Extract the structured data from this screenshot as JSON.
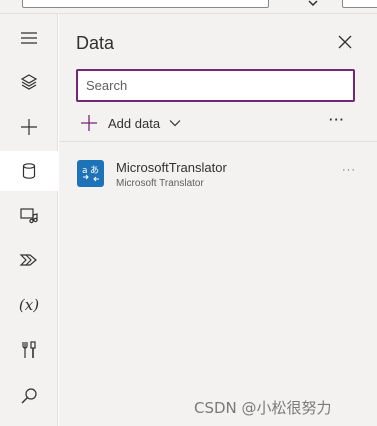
{
  "panel": {
    "title": "Data",
    "search_placeholder": "Search",
    "add_data_label": "Add data",
    "more_label": "···"
  },
  "rail": {
    "items": [
      {
        "icon": "hamburger-menu-icon",
        "active": false
      },
      {
        "icon": "layers-icon",
        "active": false
      },
      {
        "icon": "plus-icon",
        "active": false
      },
      {
        "icon": "database-icon",
        "active": true
      },
      {
        "icon": "media-icon",
        "active": false
      },
      {
        "icon": "power-automate-icon",
        "active": false
      },
      {
        "icon": "variables-icon",
        "active": false,
        "label": "(x)"
      },
      {
        "icon": "tools-icon",
        "active": false
      },
      {
        "icon": "search-icon",
        "active": false
      }
    ]
  },
  "connections": [
    {
      "name": "MicrosoftTranslator",
      "subtitle": "Microsoft Translator",
      "icon": "translator-icon",
      "more": "···"
    }
  ],
  "watermark": "CSDN @小松很努力",
  "colors": {
    "search_border": "#742774",
    "translator_bg": "#1e73b8",
    "panel_bg": "#f3f2f1"
  }
}
